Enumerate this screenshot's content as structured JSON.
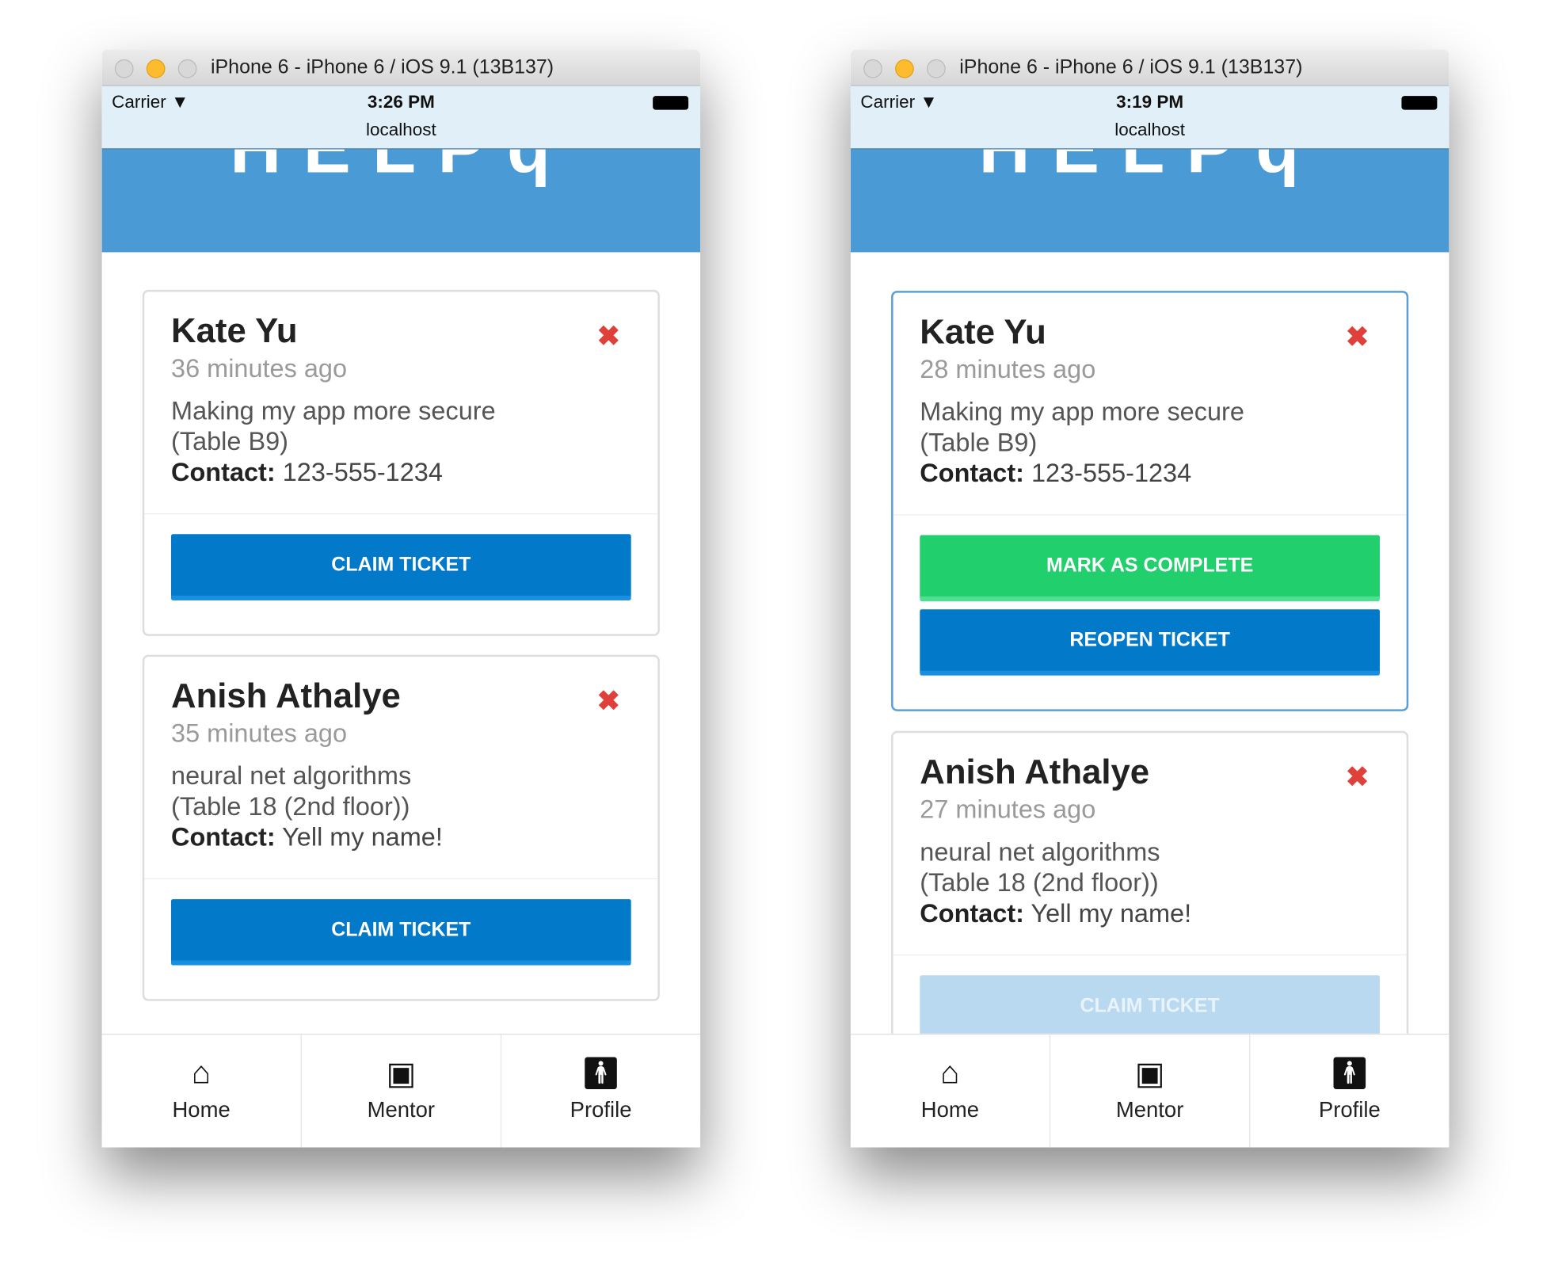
{
  "windows": [
    {
      "title": "iPhone 6 - iPhone 6 / iOS 9.1 (13B137)",
      "carrier": "Carrier",
      "time": "3:26 PM",
      "url": "localhost",
      "logo": "HELPq",
      "tickets": [
        {
          "name": "Kate Yu",
          "time": "36 minutes ago",
          "topic": "Making my app more secure",
          "location": "(Table B9)",
          "contact_label": "Contact:",
          "contact": "123-555-1234",
          "buttons": [
            "CLAIM TICKET"
          ]
        },
        {
          "name": "Anish Athalye",
          "time": "35 minutes ago",
          "topic": "neural net algorithms",
          "location": "(Table 18 (2nd floor))",
          "contact_label": "Contact:",
          "contact": "Yell my name!",
          "buttons": [
            "CLAIM TICKET"
          ]
        }
      ]
    },
    {
      "title": "iPhone 6 - iPhone 6 / iOS 9.1 (13B137)",
      "carrier": "Carrier",
      "time": "3:19 PM",
      "url": "localhost",
      "logo": "HELPq",
      "tickets": [
        {
          "name": "Kate Yu",
          "time": "28 minutes ago",
          "topic": "Making my app more secure",
          "location": "(Table B9)",
          "contact_label": "Contact:",
          "contact": "123-555-1234",
          "buttons": [
            "MARK AS COMPLETE",
            "REOPEN TICKET"
          ]
        },
        {
          "name": "Anish Athalye",
          "time": "27 minutes ago",
          "topic": "neural net algorithms",
          "location": "(Table 18 (2nd floor))",
          "contact_label": "Contact:",
          "contact": "Yell my name!",
          "buttons": [
            "CLAIM TICKET"
          ]
        }
      ]
    }
  ],
  "nav": [
    {
      "label": "Home",
      "icon": "home-icon"
    },
    {
      "label": "Mentor",
      "icon": "inbox-icon"
    },
    {
      "label": "Profile",
      "icon": "person-icon"
    }
  ],
  "colors": {
    "header": "#4a9bd5",
    "primary": "#0379c9",
    "success": "#21cf6c",
    "delete": "#e0403a",
    "disabled": "#b8d9ef"
  }
}
